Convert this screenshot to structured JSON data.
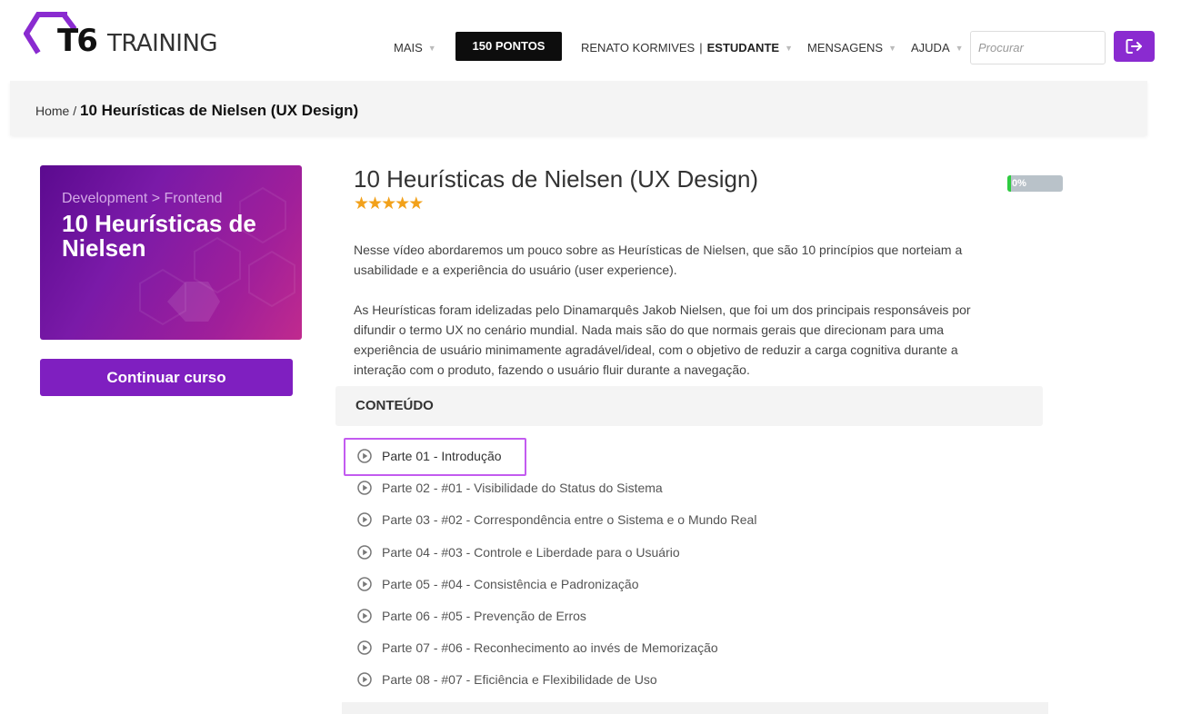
{
  "header": {
    "logo": {
      "mark": "T6",
      "text": "TRAINING",
      "brand_color": "#8a2bd0"
    },
    "nav": {
      "more_label": "MAIS",
      "points_label": "150 PONTOS",
      "user_name": "RENATO KORMIVES",
      "user_separator": "|",
      "user_role": "ESTUDANTE",
      "messages_label": "MENSAGENS",
      "help_label": "AJUDA"
    },
    "search": {
      "placeholder": "Procurar",
      "value": ""
    },
    "logout_icon": "logout-arrow-icon"
  },
  "breadcrumb": {
    "home": "Home",
    "separator": "/",
    "current": "10 Heurísticas de Nielsen (UX Design)"
  },
  "course": {
    "thumbnail": {
      "category": "Development > Frontend",
      "title": "10 Heurísticas de Nielsen"
    },
    "continue_label": "Continuar curso",
    "title": "10 Heurísticas de Nielsen (UX Design)",
    "rating": 5,
    "progress": {
      "percent": 0,
      "label": "0%"
    },
    "description": [
      "Nesse vídeo abordaremos um pouco sobre as Heurísticas de Nielsen, que são 10 princípios que norteiam a usabilidade e a experiência do usuário (user experience).",
      "As Heurísticas foram idelizadas pelo Dinamarquês Jakob Nielsen, que foi um dos principais responsáveis por difundir o termo UX no cenário mundial. Nada mais são do que normais gerais que direcionam para uma experiência de usuário minimamente agradável/ideal, com o objetivo de reduzir a carga cognitiva durante a interação com o produto, fazendo o usuário fluir durante a navegação."
    ],
    "content_header": "CONTEÚDO",
    "lessons": [
      {
        "label": "Parte 01 - Introdução",
        "icon": "play-circle-icon",
        "highlighted": true
      },
      {
        "label": "Parte 02 - #01 - Visibilidade do Status do Sistema",
        "icon": "play-circle-icon"
      },
      {
        "label": "Parte 03 - #02 - Correspondência entre o Sistema e o Mundo Real",
        "icon": "play-circle-icon"
      },
      {
        "label": "Parte 04 - #03 - Controle e Liberdade para o Usuário",
        "icon": "play-circle-icon"
      },
      {
        "label": "Parte 05 - #04 - Consistência e Padronização",
        "icon": "play-circle-icon"
      },
      {
        "label": "Parte 06 - #05 - Prevenção de Erros",
        "icon": "play-circle-icon"
      },
      {
        "label": "Parte 07 - #06 - Reconhecimento ao invés de Memorização",
        "icon": "play-circle-icon"
      },
      {
        "label": "Parte 08 - #07 - Eficiência e Flexibilidade de Uso",
        "icon": "play-circle-icon"
      }
    ],
    "colors": {
      "accent": "#8a2bd0",
      "star": "#f2a11a",
      "progress_fill": "#2ecc40",
      "highlight": "#c35bf0"
    }
  }
}
